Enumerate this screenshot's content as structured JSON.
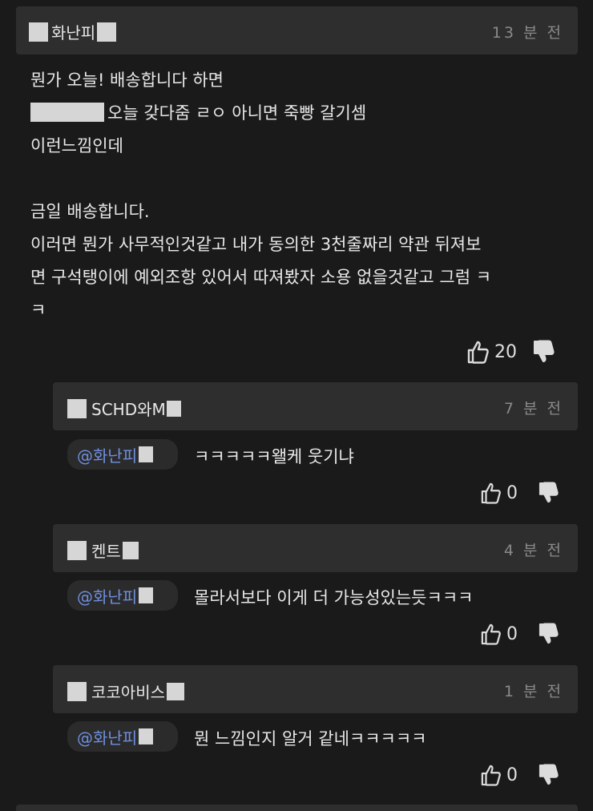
{
  "main_comment": {
    "author": "화난피",
    "time": "13 분 전",
    "lines": [
      "뭔가 오늘! 배송합니다 하면",
      "오늘 갖다줌 ㄹㅇ 아니면 죽빵 갈기셈",
      "이런느낌인데",
      "",
      "금일 배송합니다.",
      "이러면 뭔가 사무적인것같고 내가 동의한 3천줄짜리 약관 뒤져보",
      "면 구석탱이에 예외조항 있어서 따져봤자 소용 없을것같고 그럼 ㅋ",
      "ㅋ"
    ],
    "likes": "20"
  },
  "replies": [
    {
      "author": "SCHD와M",
      "time": "7 분 전",
      "mention": "@화난피",
      "text": "ㅋㅋㅋㅋㅋ왤케 웃기냐",
      "likes": "0"
    },
    {
      "author": "켄트",
      "time": "4 분 전",
      "mention": "@화난피",
      "text": "몰라서보다 이게 더 가능성있는듯ㅋㅋㅋ",
      "likes": "0"
    },
    {
      "author": "코코아비스",
      "time": "1 분 전",
      "mention": "@화난피",
      "text": "뭔 느낌인지 알거 같네ㅋㅋㅋㅋㅋ",
      "likes": "0"
    }
  ],
  "icons": {
    "like": "thumbs-up-icon",
    "dislike": "thumbs-down-icon"
  }
}
